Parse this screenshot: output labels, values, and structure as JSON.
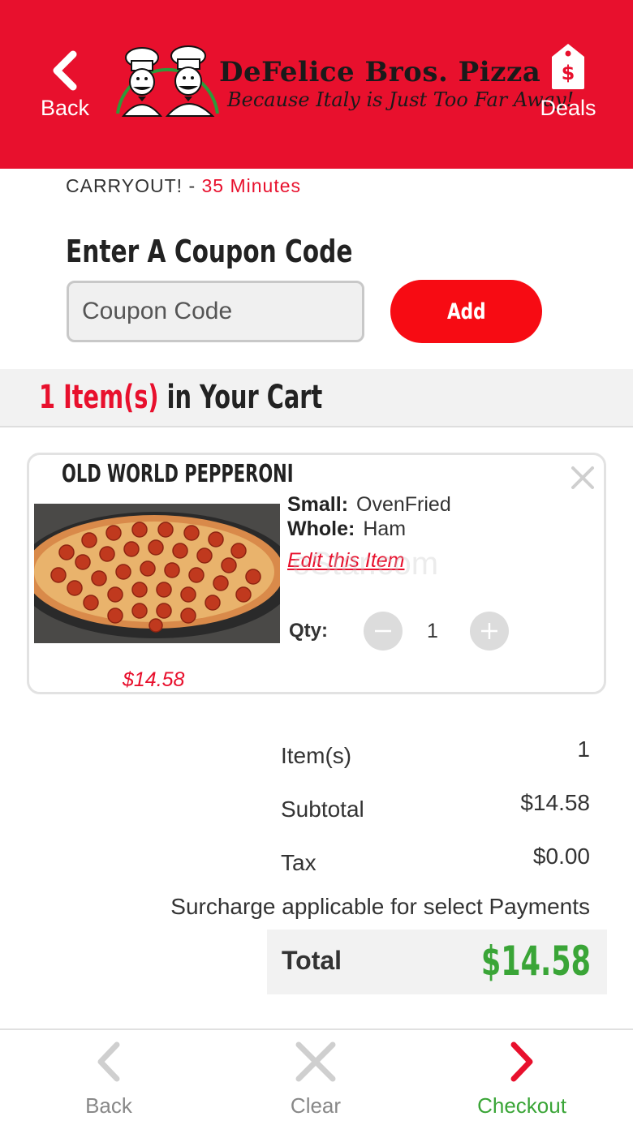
{
  "header": {
    "back_label": "Back",
    "deals_label": "Deals",
    "brand_name": "DeFelice Bros. Pizza",
    "brand_tagline": "Because Italy is Just Too Far Away!",
    "bg_color": "#e8102d"
  },
  "order_type": {
    "label": "CARRYOUT!",
    "separator": "-",
    "time": "35 Minutes"
  },
  "coupon": {
    "title": "Enter A Coupon Code",
    "placeholder": "Coupon Code",
    "value": "",
    "add_label": "Add"
  },
  "cart": {
    "count_label": "1 Item(s)",
    "suffix": "in Your Cart"
  },
  "item": {
    "name": "OLD WORLD PEPPERONI",
    "options": [
      {
        "label": "Small:",
        "value": "OvenFried"
      },
      {
        "label": "Whole:",
        "value": "Ham"
      }
    ],
    "edit_label": "Edit this Item",
    "qty_label": "Qty:",
    "qty": "1",
    "price": "$14.58"
  },
  "summary": {
    "items_label": "Item(s)",
    "items_value": "1",
    "subtotal_label": "Subtotal",
    "subtotal_value": "$14.58",
    "tax_label": "Tax",
    "tax_value": "$0.00",
    "surcharge_note": "Surcharge applicable for select Payments",
    "total_label": "Total",
    "total_value": "$14.58"
  },
  "bottom_nav": {
    "back_label": "Back",
    "clear_label": "Clear",
    "checkout_label": "Checkout"
  },
  "colors": {
    "accent_red": "#e8102d",
    "add_button": "#f70b13",
    "total_green": "#3aa537",
    "muted_gray": "#c8c8c8"
  },
  "watermark": "eStar.com"
}
